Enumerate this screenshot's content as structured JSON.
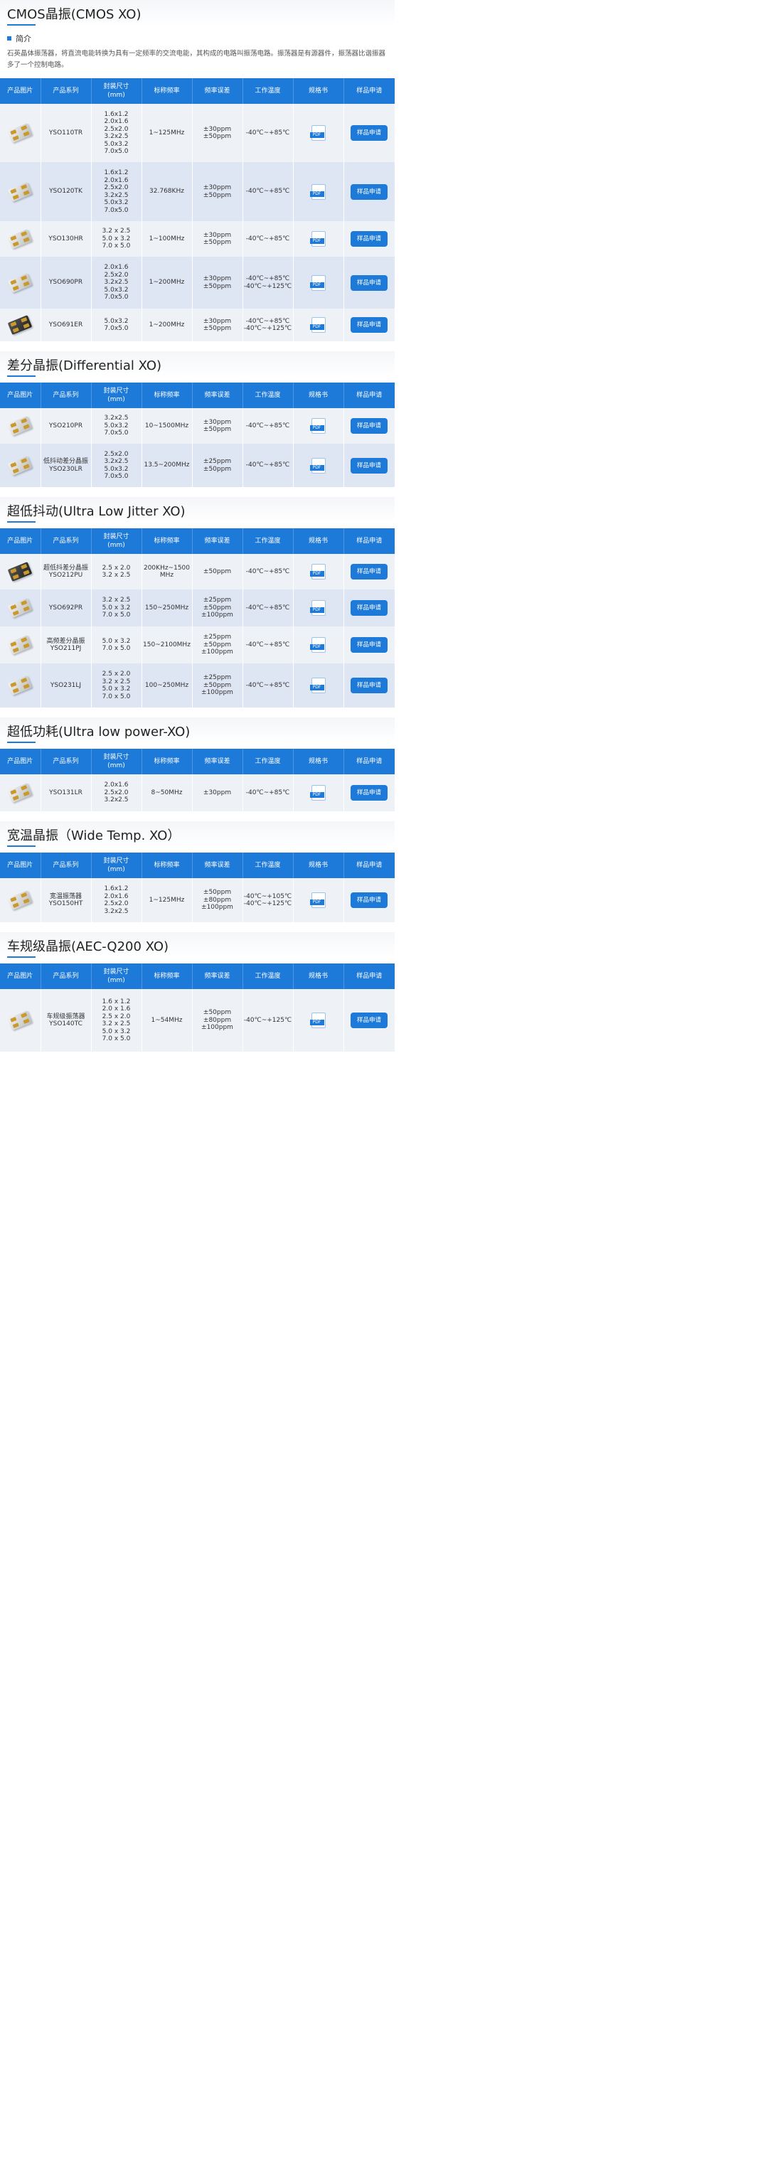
{
  "headers": [
    "产品图片",
    "产品系列",
    "封装尺寸\n(mm)",
    "标称频率",
    "频率误差",
    "工作温度",
    "规格书",
    "样品申请"
  ],
  "pdf_label": "PDF",
  "apply_label": "样品申请",
  "intro_label": "简介",
  "intro_text": "石英晶体振荡器，将直流电能转换为具有一定频率的交流电能，其构成的电路叫振荡电路。振荡器是有源器件，振荡器比谐振器多了一个控制电路。",
  "sections": [
    {
      "title": "CMOS晶振(CMOS XO)",
      "rows": [
        {
          "series": "YSO110TR",
          "size": "1.6x1.2\n2.0x1.6\n2.5x2.0\n3.2x2.5\n5.0x3.2\n7.0x5.0",
          "freq": "1~125MHz",
          "tol": "±30ppm\n±50ppm",
          "temp": "-40℃~+85℃",
          "chip": "light"
        },
        {
          "series": "YSO120TK",
          "size": "1.6x1.2\n2.0x1.6\n2.5x2.0\n3.2x2.5\n5.0x3.2\n7.0x5.0",
          "freq": "32.768KHz",
          "tol": "±30ppm\n±50ppm",
          "temp": "-40℃~+85℃",
          "chip": "light"
        },
        {
          "series": "YSO130HR",
          "size": "3.2 x 2.5\n5.0 x 3.2\n7.0 x 5.0",
          "freq": "1~100MHz",
          "tol": "±30ppm\n±50ppm",
          "temp": "-40℃~+85℃",
          "chip": "light"
        },
        {
          "series": "YSO690PR",
          "size": "2.0x1.6\n2.5x2.0\n3.2x2.5\n5.0x3.2\n7.0x5.0",
          "freq": "1~200MHz",
          "tol": "±30ppm\n±50ppm",
          "temp": "-40℃~+85℃\n-40℃~+125℃",
          "chip": "light"
        },
        {
          "series": "YSO691ER",
          "size": "5.0x3.2\n7.0x5.0",
          "freq": "1~200MHz",
          "tol": "±30ppm\n±50ppm",
          "temp": "-40℃~+85℃\n-40℃~+125℃",
          "chip": "dark"
        }
      ]
    },
    {
      "title": "差分晶振(Differential XO)",
      "rows": [
        {
          "series": "YSO210PR",
          "size": "3.2x2.5\n5.0x3.2\n7.0x5.0",
          "freq": "10~1500MHz",
          "tol": "±30ppm\n±50ppm",
          "temp": "-40℃~+85℃",
          "chip": "light"
        },
        {
          "series": "低抖动差分晶振\nYSO230LR",
          "size": "2.5x2.0\n3.2x2.5\n5.0x3.2\n7.0x5.0",
          "freq": "13.5~200MHz",
          "tol": "±25ppm\n±50ppm",
          "temp": "-40℃~+85℃",
          "chip": "light"
        }
      ]
    },
    {
      "title": "超低抖动(Ultra Low Jitter XO)",
      "rows": [
        {
          "series": "超低抖差分晶振\nYSO212PU",
          "size": "2.5 x 2.0\n3.2 x 2.5",
          "freq": "200KHz~1500\nMHz",
          "tol": "±50ppm",
          "temp": "-40℃~+85℃",
          "chip": "dark"
        },
        {
          "series": "YSO692PR",
          "size": "3.2 x 2.5\n5.0 x 3.2\n7.0 x 5.0",
          "freq": "150~250MHz",
          "tol": "±25ppm\n±50ppm\n±100ppm",
          "temp": "-40℃~+85℃",
          "chip": "light"
        },
        {
          "series": "高频差分晶振\nYSO211PJ",
          "size": "5.0 x 3.2\n7.0 x 5.0",
          "freq": "150~2100MHz",
          "tol": "±25ppm\n±50ppm\n±100ppm",
          "temp": "-40℃~+85℃",
          "chip": "light"
        },
        {
          "series": "YSO231LJ",
          "size": "2.5 x 2.0\n3.2 x 2.5\n5.0 x 3.2\n7.0 x 5.0",
          "freq": "100~250MHz",
          "tol": "±25ppm\n±50ppm\n±100ppm",
          "temp": "-40℃~+85℃",
          "chip": "light"
        }
      ]
    },
    {
      "title": "超低功耗(Ultra low power-XO)",
      "rows": [
        {
          "series": "YSO131LR",
          "size": "2.0x1.6\n2.5x2.0\n3.2x2.5",
          "freq": "8~50MHz",
          "tol": "±30ppm",
          "temp": "-40℃~+85℃",
          "chip": "light"
        }
      ]
    },
    {
      "title": "宽温晶振（Wide Temp. XO）",
      "rows": [
        {
          "series": "宽温振荡器\nYSO150HT",
          "size": "1.6x1.2\n2.0x1.6\n2.5x2.0\n3.2x2.5",
          "freq": "1~125MHz",
          "tol": "±50ppm\n±80ppm\n±100ppm",
          "temp": "-40℃~+105℃\n-40℃~+125℃",
          "chip": "light"
        }
      ]
    },
    {
      "title": "车规级晶振(AEC-Q200 XO)",
      "rows": [
        {
          "series": "车规级振荡器\nYSO140TC",
          "size": "1.6 x 1.2\n2.0 x 1.6\n2.5 x 2.0\n3.2 x 2.5\n5.0 x 3.2\n7.0 x 5.0",
          "freq": "1~54MHz",
          "tol": "±50ppm\n±80ppm\n±100ppm",
          "temp": "-40℃~+125℃",
          "chip": "light"
        }
      ]
    }
  ]
}
